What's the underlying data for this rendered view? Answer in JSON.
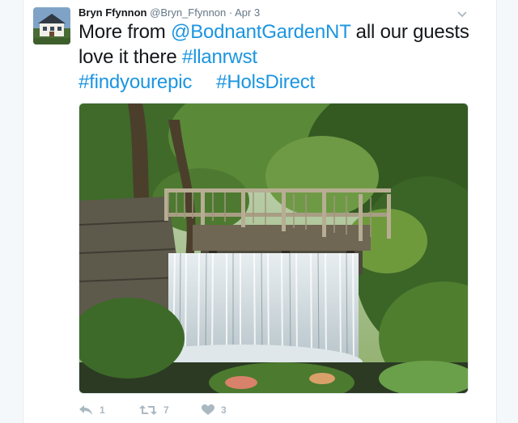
{
  "tweet": {
    "display_name": "Bryn Ffynnon",
    "handle": "@Bryn_Ffynnon",
    "separator": "·",
    "timestamp": "Apr 3",
    "avatar_icon": "profile-photo-house",
    "text_before": "More from ",
    "mention": "@BodnantGardenNT",
    "text_middle": " all our guests love it there ",
    "hashtag_1": "#llanrwst",
    "hashtag_2": "#findyourepic",
    "hashtag_3": "#HolsDirect",
    "media_alt": "Photo of a wooden footbridge over a stone weir with a waterfall, surrounded by trees",
    "media_icon": "waterfall-bridge-photo"
  },
  "actions": {
    "reply_icon": "reply-icon",
    "reply_count": "1",
    "retweet_icon": "retweet-icon",
    "retweet_count": "7",
    "like_icon": "heart-icon",
    "like_count": "3"
  },
  "colors": {
    "link": "#1b95e0",
    "muted": "#657786",
    "action": "#aab8c2",
    "background": "#f5f8fa"
  }
}
